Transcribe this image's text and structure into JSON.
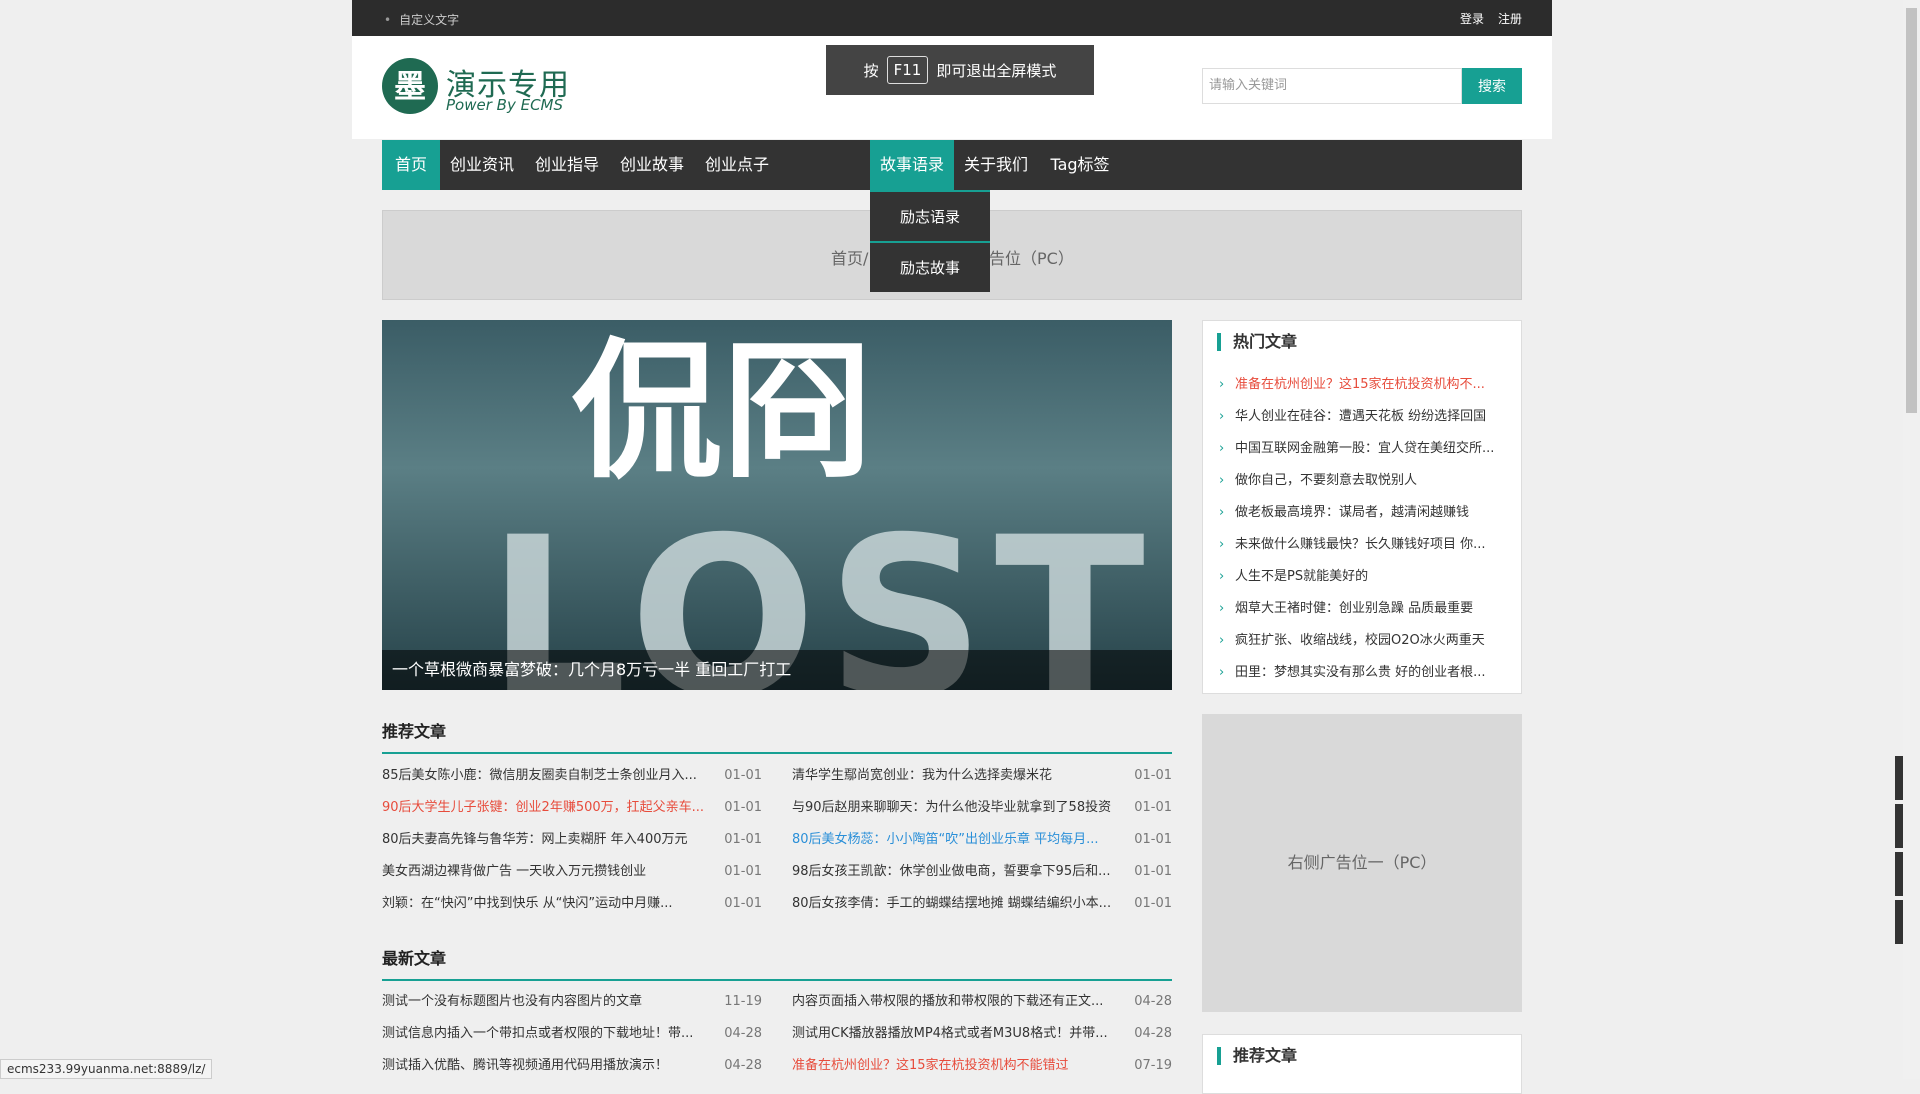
{
  "topbar": {
    "custom_text": "自定义文字",
    "login": "登录",
    "register": "注册"
  },
  "logo": {
    "mark": "墨",
    "title": "演示专用",
    "subtitle": "Power By ECMS"
  },
  "f11_notice": {
    "prefix": "按",
    "key": "F11",
    "suffix": "即可退出全屏模式"
  },
  "search": {
    "placeholder": "请输入关键词",
    "button": "搜索"
  },
  "nav": {
    "items": [
      "首页",
      "创业资讯",
      "创业指导",
      "创业故事",
      "创业点子",
      "故事语录",
      "关于我们",
      "Tag标签"
    ]
  },
  "dropdown": {
    "items": [
      "励志语录",
      "励志故事"
    ]
  },
  "adbar": {
    "left": "首页/",
    "right": "告位（PC）"
  },
  "hero": {
    "big1": "侃冏",
    "big2": "LOST",
    "caption": "一个草根微商暴富梦破：几个月8万亏一半 重回工厂打工"
  },
  "recommended": {
    "title": "推荐文章",
    "left": [
      {
        "t": "85后美女陈小鹿：微信朋友圈卖自制芝士条创业月入...",
        "d": "01-01"
      },
      {
        "t": "90后大学生儿子张键：创业2年赚500万，扛起父亲车...",
        "d": "01-01"
      },
      {
        "t": "80后夫妻高先锋与鲁华芳：网上卖糊肝 年入400万元",
        "d": "01-01"
      },
      {
        "t": "美女西湖边裸背做广告 一天收入万元攒钱创业",
        "d": "01-01"
      },
      {
        "t": "刘颖：在“快闪”中找到快乐 从“快闪”运动中月赚...",
        "d": "01-01"
      }
    ],
    "right": [
      {
        "t": "清华学生鄢尚宽创业：我为什么选择卖爆米花",
        "d": "01-01"
      },
      {
        "t": "与90后赵朋来聊聊天：为什么他没毕业就拿到了58投资",
        "d": "01-01"
      },
      {
        "t": "80后美女杨蕊：小小陶笛“吹”出创业乐章 平均每月...",
        "d": "01-01"
      },
      {
        "t": "98后女孩王凯歆：休学创业做电商，誓要拿下95后和...",
        "d": "01-01"
      },
      {
        "t": "80后女孩李倩：手工的蝴蝶结摆地摊 蝴蝶结编织小本...",
        "d": "01-01"
      }
    ]
  },
  "latest": {
    "title": "最新文章",
    "left": [
      {
        "t": "测试一个没有标题图片也没有内容图片的文章",
        "d": "11-19"
      },
      {
        "t": "测试信息内插入一个带扣点或者权限的下载地址！带...",
        "d": "04-28"
      },
      {
        "t": "测试插入优酷、腾讯等视频通用代码用播放演示！",
        "d": "04-28"
      }
    ],
    "right": [
      {
        "t": "内容页面插入带权限的播放和带权限的下载还有正文...",
        "d": "04-28"
      },
      {
        "t": "测试用CK播放器播放MP4格式或者M3U8格式！并带...",
        "d": "04-28"
      },
      {
        "t": "准备在杭州创业？这15家在杭投资机构不能错过",
        "d": "07-19"
      }
    ]
  },
  "hot": {
    "title": "热门文章",
    "items": [
      "准备在杭州创业？这15家在杭投资机构不...",
      "华人创业在硅谷：遭遇天花板 纷纷选择回国",
      "中国互联网金融第一股：宜人贷在美纽交所...",
      "做你自己，不要刻意去取悦别人",
      "做老板最高境界：谋局者，越清闲越赚钱",
      "未来做什么赚钱最快？长久赚钱好项目 你...",
      "人生不是PS就能美好的",
      "烟草大王褚时健：创业别急躁 品质最重要",
      "疯狂扩张、收缩战线，校园O2O冰火两重天",
      "田里：梦想其实没有那么贵 好的创业者根..."
    ]
  },
  "side_ad": "右侧广告位一（PC）",
  "side_rec_title": "推荐文章",
  "status_url": "ecms233.99yuanma.net:8889/lz/",
  "colors": {
    "accent": "#17a093",
    "dark": "#333333",
    "red": "#e74c3c",
    "blue": "#2a8fd8"
  },
  "float_icons": [
    "qq-icon",
    "phone-icon",
    "qrcode-icon",
    "cart-icon"
  ]
}
